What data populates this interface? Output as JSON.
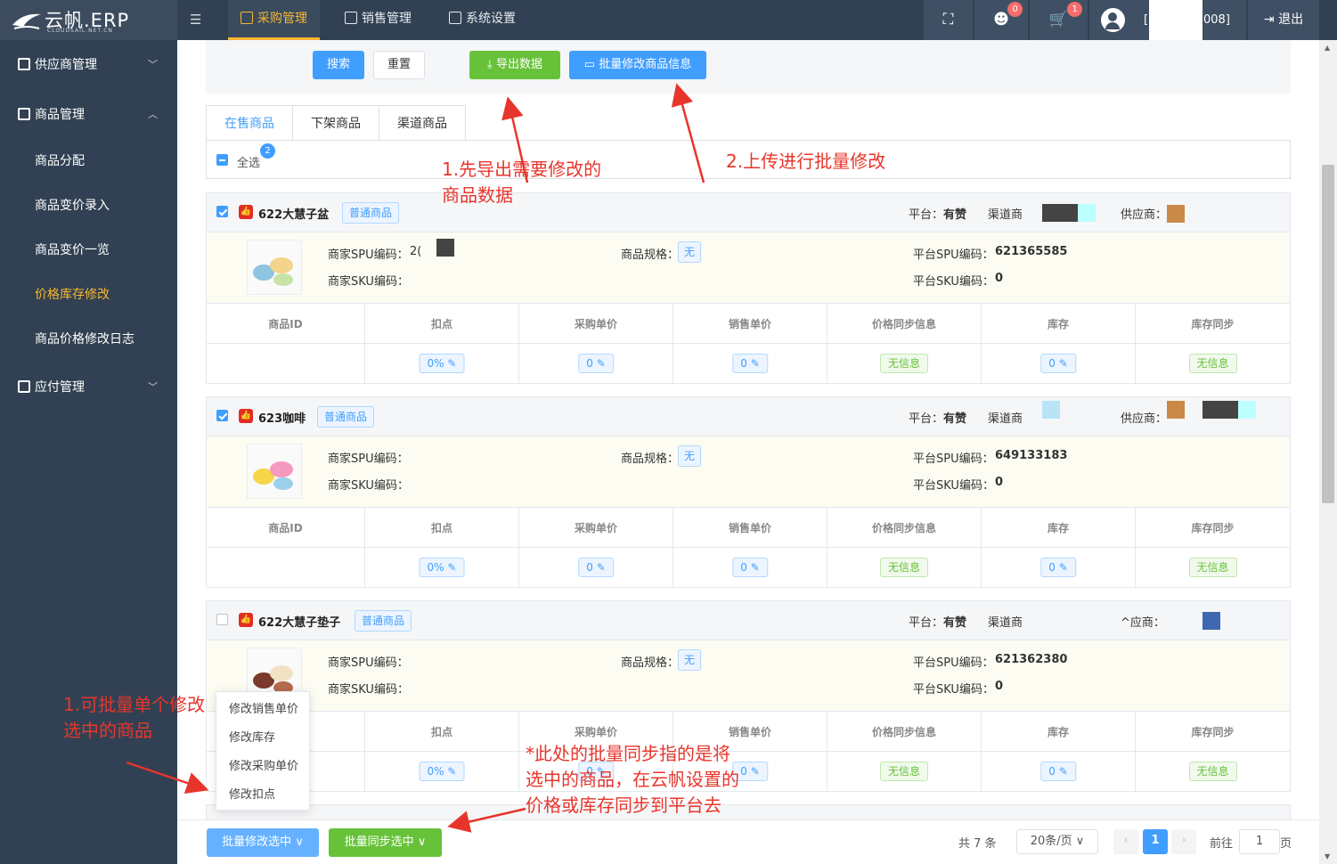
{
  "app": {
    "logo_text": "云帆.ERP",
    "logo_domain": "CLOUDSAIL.NET.CN"
  },
  "topnav": [
    {
      "label": "采购管理",
      "active": true
    },
    {
      "label": "销售管理",
      "active": false
    },
    {
      "label": "系统设置",
      "active": false
    }
  ],
  "header": {
    "notify_count": "0",
    "cart_count": "1",
    "user_prefix": "[",
    "user_suffix": "008]",
    "logout_label": "退出"
  },
  "sidebar": {
    "groups": [
      {
        "label": "供应商管理"
      },
      {
        "label": "商品管理"
      },
      {
        "label": "应付管理"
      }
    ],
    "items": [
      {
        "label": "商品分配"
      },
      {
        "label": "商品变价录入"
      },
      {
        "label": "商品变价一览"
      },
      {
        "label": "价格库存修改",
        "active": true
      },
      {
        "label": "商品价格修改日志"
      }
    ]
  },
  "toolbar": {
    "search": "搜索",
    "reset": "重置",
    "export": "导出数据",
    "batch_edit": "批量修改商品信息"
  },
  "tabs": [
    {
      "label": "在售商品",
      "active": true
    },
    {
      "label": "下架商品"
    },
    {
      "label": "渠道商品"
    }
  ],
  "select_all": {
    "label": "全选",
    "count": "2"
  },
  "columns": [
    "商品ID",
    "扣点",
    "采购单价",
    "销售单价",
    "价格同步信息",
    "库存",
    "库存同步"
  ],
  "labels": {
    "platform": "平台：",
    "channel": "渠道商",
    "supplier": "供应商：",
    "merchant_spu": "商家SPU编码：",
    "merchant_sku": "商家SKU编码：",
    "spec": "商品规格：",
    "platform_spu": "平台SPU编码：",
    "platform_sku": "平台SKU编码："
  },
  "products": [
    {
      "name": "622大慧子盆",
      "tag": "普通商品",
      "checked": true,
      "platform": "有赞",
      "merchant_spu": "2(",
      "spec": "无",
      "platform_spu": "621365585",
      "platform_sku": "0",
      "discount": "0%",
      "purchase_price": "0",
      "sale_price": "0",
      "price_sync": "无信息",
      "stock": "0",
      "stock_sync": "无信息",
      "supplier": ""
    },
    {
      "name": "623咖啡",
      "tag": "普通商品",
      "checked": true,
      "platform": "有赞",
      "merchant_spu": "",
      "spec": "无",
      "platform_spu": "649133183",
      "platform_sku": "0",
      "discount": "0%",
      "purchase_price": "0",
      "sale_price": "0",
      "price_sync": "无信息",
      "stock": "0",
      "stock_sync": "无信息",
      "supplier": ""
    },
    {
      "name": "622大慧子垫子",
      "tag": "普通商品",
      "checked": false,
      "platform": "有赞",
      "merchant_spu": "",
      "spec": "无",
      "platform_spu": "621362380",
      "platform_sku": "0",
      "discount": "0%",
      "purchase_price": "0",
      "sale_price": "0",
      "price_sync": "无信息",
      "stock": "0",
      "stock_sync": "无信息",
      "supplier": "^应商："
    }
  ],
  "dropdown": [
    "修改销售单价",
    "修改库存",
    "修改采购单价",
    "修改扣点"
  ],
  "footer": {
    "batch_edit": "批量修改选中",
    "batch_sync": "批量同步选中",
    "total": "共 7 条",
    "page_size": "20条/页",
    "current_page": "1",
    "goto_label": "前往",
    "goto_value": "1",
    "page_unit": "页"
  },
  "annotations": {
    "a1": "1.先导出需要修改的商品数据",
    "a2": "2.上传进行批量修改",
    "a3": "1.可批量单个修改选中的商品",
    "a4": "*此处的批量同步指的是将选中的商品，在云帆设置的价格或库存同步到平台去"
  },
  "colors": {
    "primary": "#409eff",
    "success": "#67c23a",
    "sidebar": "#314153",
    "active": "#f7b731",
    "annotation": "#e8352c"
  }
}
